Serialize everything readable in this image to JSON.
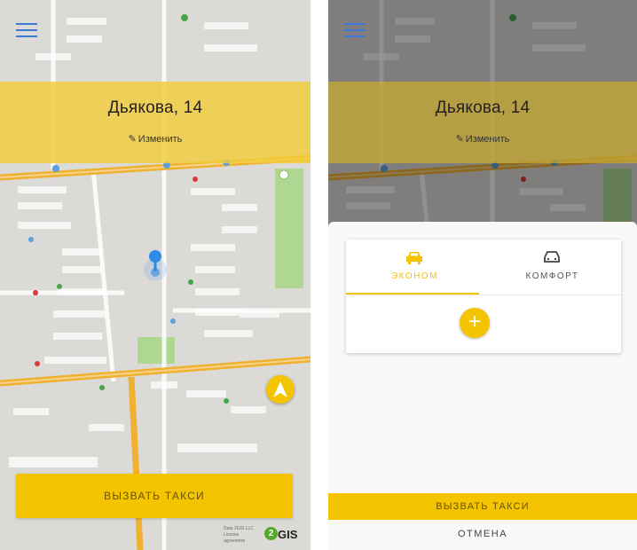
{
  "left_screen": {
    "address": "Дьякова, 14",
    "edit_label": "Изменить",
    "call_taxi_label": "ВЫЗВАТЬ ТАКСИ",
    "attribution": "Data 2GIS LLC License agreement",
    "map_logo": "2GIS"
  },
  "right_screen": {
    "address": "Дьякова, 14",
    "edit_label": "Изменить",
    "tabs": [
      {
        "label": "ЭКОНОМ",
        "selected": true
      },
      {
        "label": "КОМФОРТ",
        "selected": false
      }
    ],
    "add_label": "+",
    "call_taxi_label": "ВЫЗВАТЬ ТАКСИ",
    "cancel_label": "ОТМЕНА"
  },
  "icons": {
    "menu": "hamburger-icon",
    "edit": "pencil-icon",
    "pin": "location-pin-icon",
    "compass": "navigation-arrow-icon",
    "car": "car-icon"
  },
  "colors": {
    "accent": "#f5c400",
    "banner": "#f2cd3c",
    "menu": "#3b7ad8",
    "pin": "#2f8be8",
    "road": "#f0b030",
    "park": "#a8d68a"
  }
}
